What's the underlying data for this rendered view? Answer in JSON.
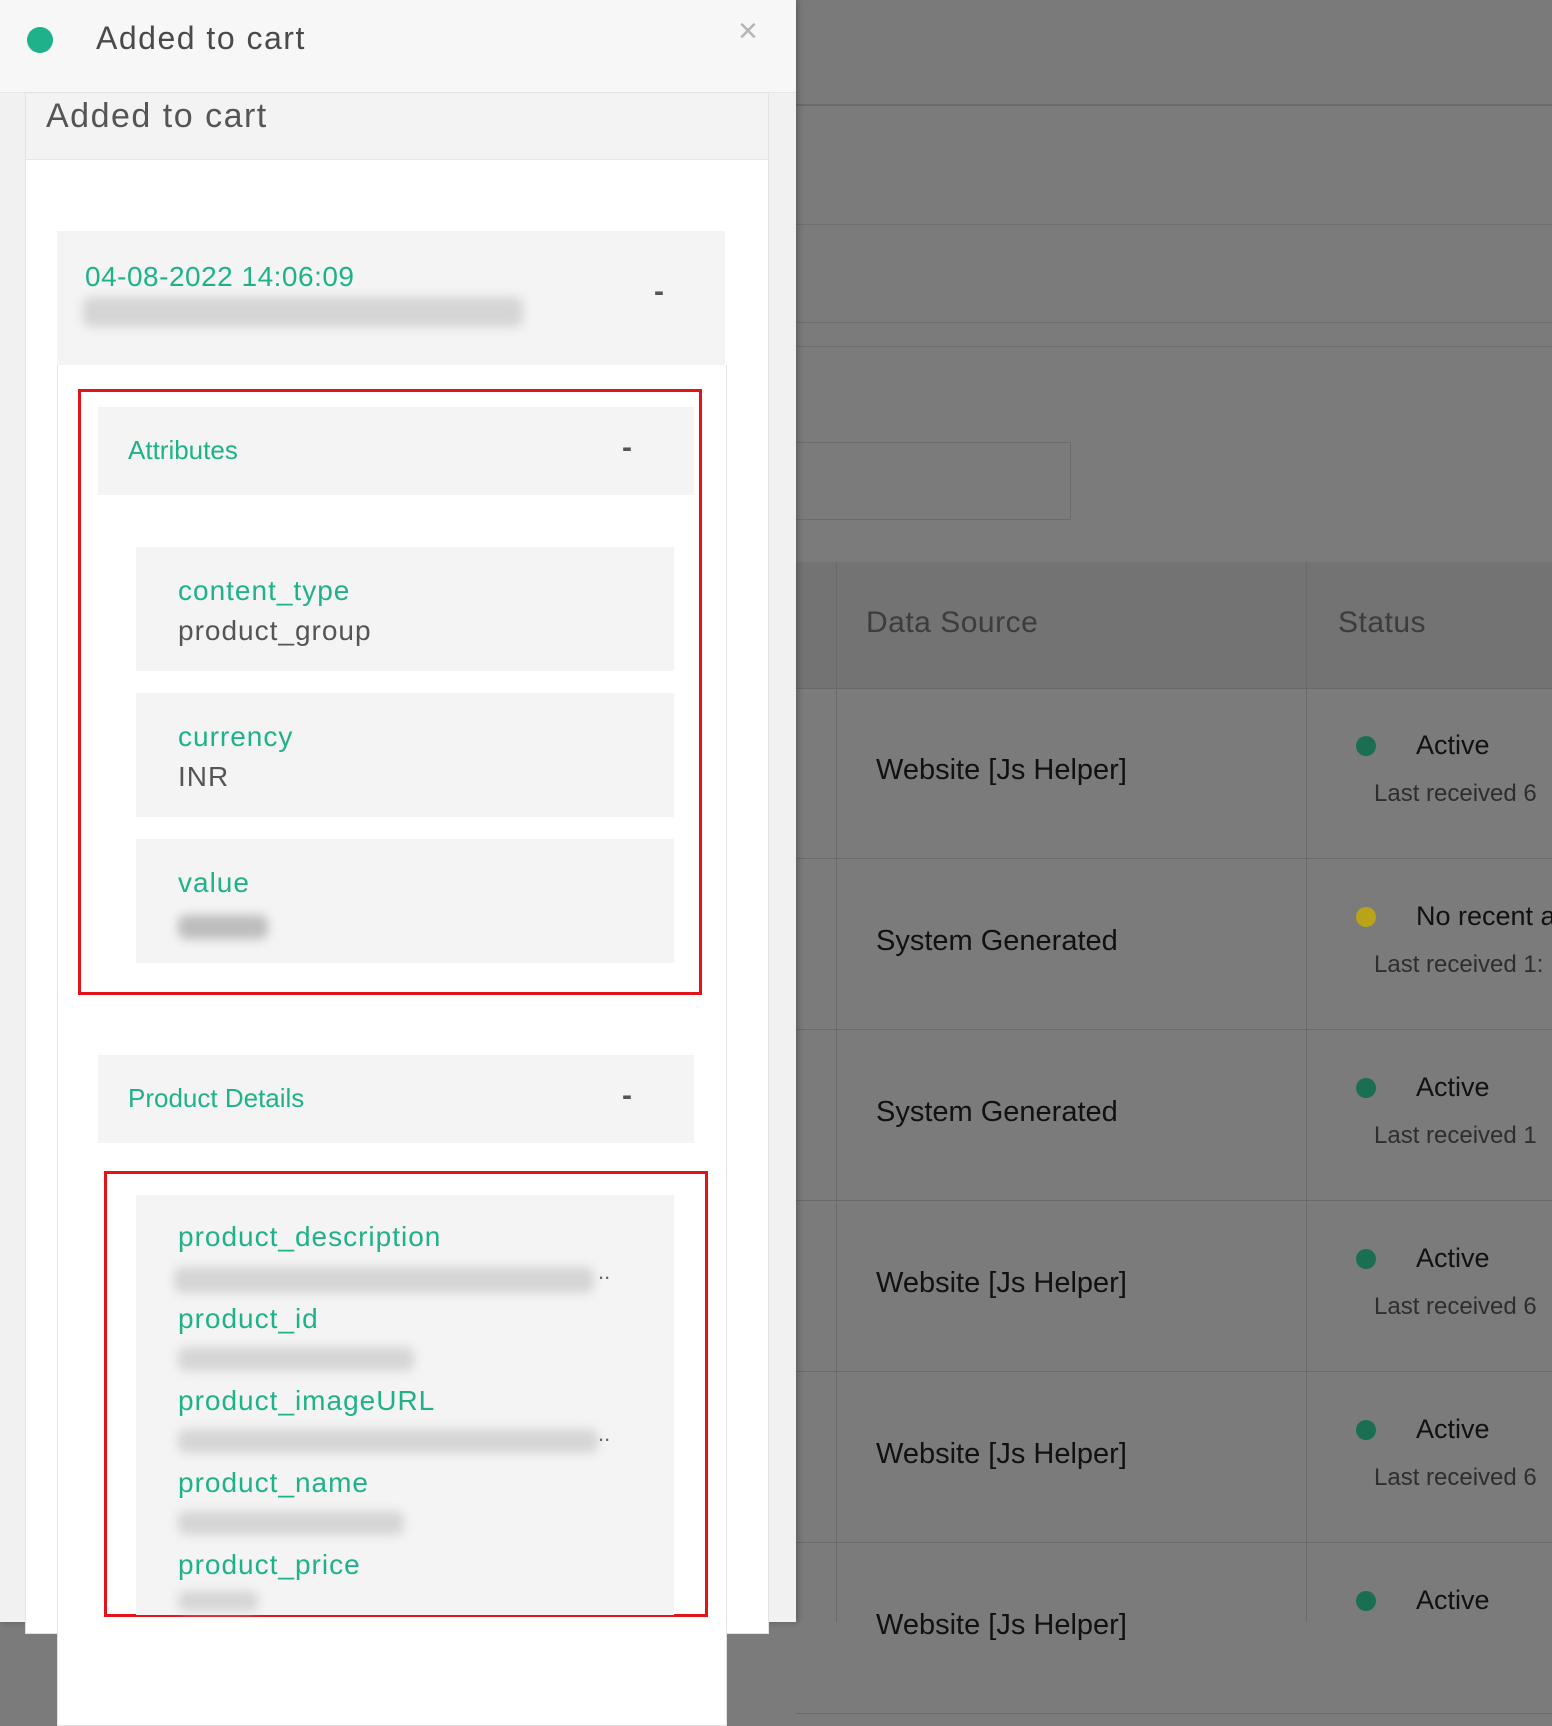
{
  "drawer": {
    "title": "Added to cart",
    "close_icon": "×",
    "card_title": "Added to cart",
    "event": {
      "datetime": "04-08-2022 14:06:09",
      "toggle": "-"
    },
    "attributes": {
      "title": "Attributes",
      "toggle": "-",
      "items": [
        {
          "key": "content_type",
          "value": "product_group"
        },
        {
          "key": "currency",
          "value": "INR"
        },
        {
          "key": "value",
          "value": ""
        }
      ]
    },
    "product_details": {
      "title": "Product Details",
      "toggle": "-",
      "keys": [
        "product_description",
        "product_id",
        "product_imageURL",
        "product_name",
        "product_price"
      ],
      "ellipsis": ".."
    }
  },
  "background": {
    "table": {
      "headers": {
        "data_source": "Data Source",
        "status": "Status"
      },
      "rows": [
        {
          "source": "Website [Js Helper]",
          "status": "Active",
          "last": "Last received 6"
        },
        {
          "source": "System Generated",
          "status": "No recent a",
          "last": "Last received 1:"
        },
        {
          "source": "System Generated",
          "status": "Active",
          "last": "Last received 1"
        },
        {
          "source": "Website [Js Helper]",
          "status": "Active",
          "last": "Last received 6"
        },
        {
          "source": "Website [Js Helper]",
          "status": "Active",
          "last": "Last received 6"
        },
        {
          "source": "Website [Js Helper]",
          "status": "Active",
          "last": ""
        }
      ]
    },
    "colors": {
      "active": "#1a6e52",
      "warning": "#b9a317"
    }
  }
}
